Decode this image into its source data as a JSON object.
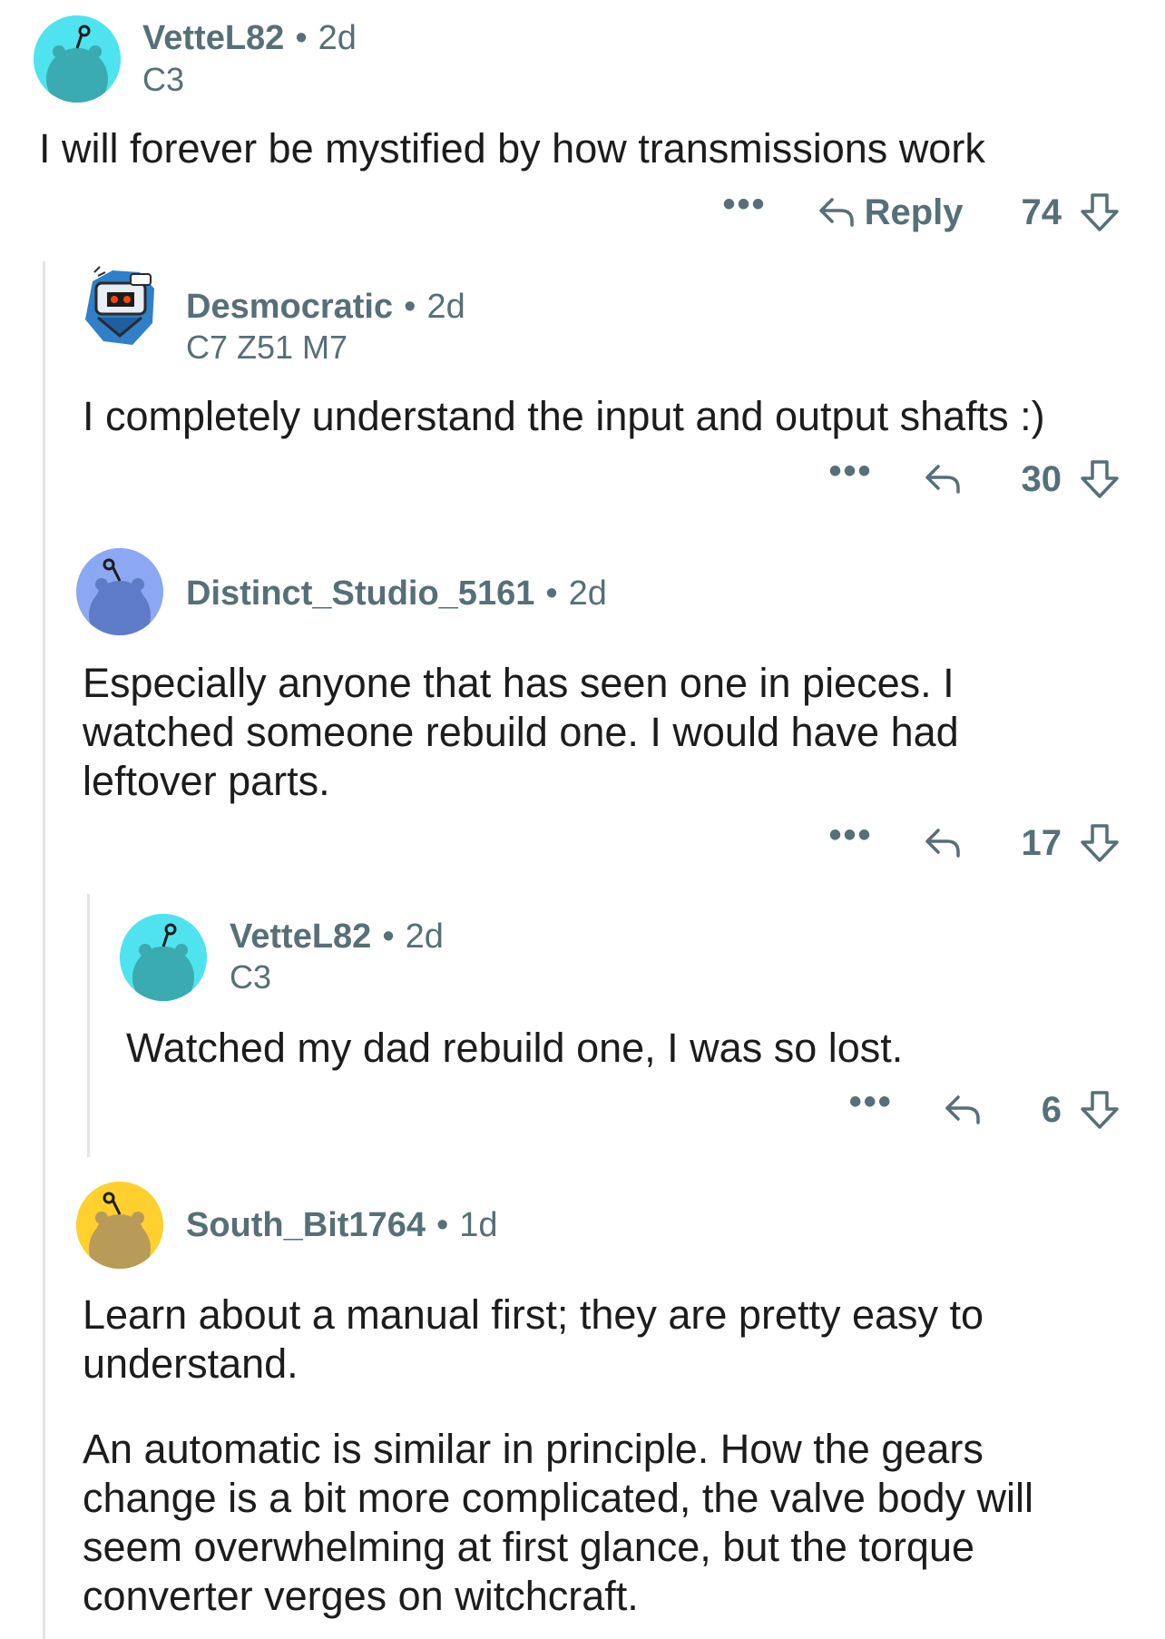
{
  "comments": [
    {
      "username": "VetteL82",
      "separator": "•",
      "age": "2d",
      "flair": "C3",
      "body": [
        "I will forever be mystified by how transmissions work"
      ],
      "more": "•••",
      "reply_label": "Reply",
      "score": "74",
      "avatar_color": "#4fe3ef"
    },
    {
      "username": "Desmocratic",
      "separator": "•",
      "age": "2d",
      "flair": "C7 Z51 M7",
      "body": [
        "I completely understand the input and output shafts :)"
      ],
      "more": "•••",
      "score": "30",
      "avatar_color": "#ffffff"
    },
    {
      "username": "Distinct_Studio_5161",
      "separator": "•",
      "age": "2d",
      "body": [
        "Especially anyone that has seen one in pieces. I watched someone rebuild one. I would have had leftover parts."
      ],
      "more": "•••",
      "score": "17",
      "avatar_color": "#8ca8f2"
    },
    {
      "username": "VetteL82",
      "separator": "•",
      "age": "2d",
      "flair": "C3",
      "body": [
        "Watched my dad rebuild one, I was so lost."
      ],
      "more": "•••",
      "score": "6",
      "avatar_color": "#4fe3ef"
    },
    {
      "username": "South_Bit1764",
      "separator": "•",
      "age": "1d",
      "body": [
        "Learn about a manual first; they are pretty easy to understand.",
        "An automatic is similar in principle. How the gears change is a bit more complicated, the valve body will seem overwhelming at first glance, but the torque converter verges on witchcraft."
      ],
      "avatar_color": "#ffd02e"
    }
  ],
  "colors": {
    "meta_text": "#576f76",
    "body_text": "#1c1c1c",
    "thread_line": "#e5e5e5"
  },
  "icons": {
    "more": "more-dots-icon",
    "reply": "reply-arrow-icon",
    "upvote": "upvote-arrow-icon",
    "downvote": "downvote-arrow-icon"
  }
}
